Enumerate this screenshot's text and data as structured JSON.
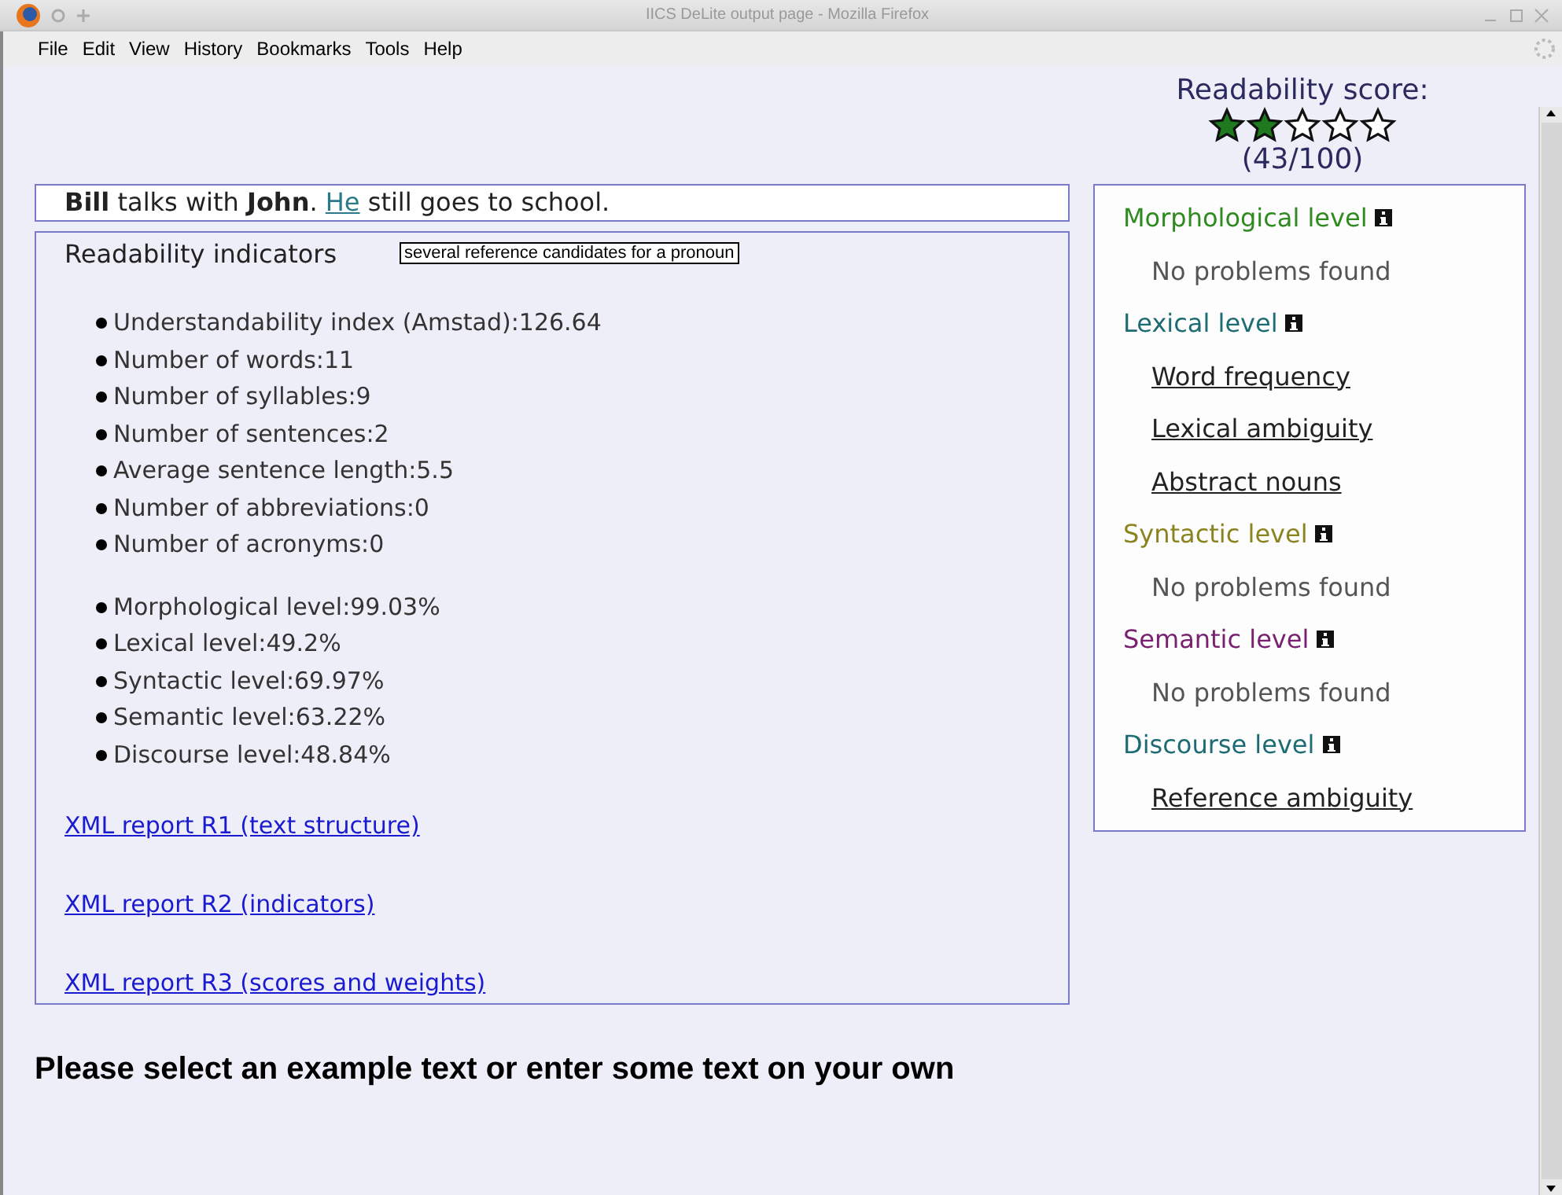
{
  "window": {
    "title": "IICS DeLite output page - Mozilla Firefox"
  },
  "menu": [
    "File",
    "Edit",
    "View",
    "History",
    "Bookmarks",
    "Tools",
    "Help"
  ],
  "score": {
    "title": "Readability score:",
    "stars": 2,
    "value": "(43/100)"
  },
  "sentence": {
    "before": "**Bill** talks with **John**. ",
    "link": "He",
    "after": " still goes to school."
  },
  "indicators": {
    "title": "Readability indicators",
    "tooltip": "several reference candidates for a pronoun",
    "groups": [
      [
        "Understandability index (Amstad):126.64",
        "Number of words:11",
        "Number of syllables:9",
        "Number of sentences:2",
        "Average sentence length:5.5",
        "Number of abbreviations:0",
        "Number of acronyms:0"
      ],
      [
        "Morphological level:99.03%",
        "Lexical level:49.2%",
        "Syntactic level:69.97%",
        "Semantic level:63.22%",
        "Discourse level:48.84%"
      ]
    ],
    "reports": [
      "XML report R1 (text structure)",
      "XML report R2 (indicators)",
      "XML report R3 (scores and weights)"
    ]
  },
  "levels": [
    {
      "name": "Morphological level",
      "color": "#2f8a1f",
      "items": [
        {
          "text": "No problems found",
          "kind": "plain"
        }
      ]
    },
    {
      "name": "Lexical level",
      "color": "#1d6b73",
      "items": [
        {
          "text": "Word frequency",
          "kind": "link"
        },
        {
          "text": "Lexical ambiguity",
          "kind": "link"
        },
        {
          "text": "Abstract nouns",
          "kind": "link"
        }
      ]
    },
    {
      "name": "Syntactic level",
      "color": "#8a8420",
      "items": [
        {
          "text": "No problems found",
          "kind": "plain"
        }
      ]
    },
    {
      "name": "Semantic level",
      "color": "#7a2070",
      "items": [
        {
          "text": "No problems found",
          "kind": "plain"
        }
      ]
    },
    {
      "name": "Discourse level",
      "color": "#1d6b73",
      "items": [
        {
          "text": "Reference ambiguity",
          "kind": "link"
        }
      ]
    }
  ],
  "prompt": "Please select an example text or enter some text on your own"
}
